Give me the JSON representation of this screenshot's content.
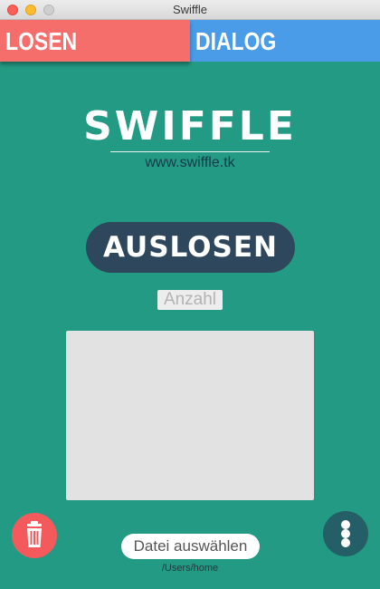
{
  "window": {
    "title": "Swiffle"
  },
  "tabs": [
    {
      "label": "LOSEN",
      "color": "#f56e6c",
      "active": true
    },
    {
      "label": "DIALOG",
      "color": "#4a9be8",
      "active": false
    }
  ],
  "brand": {
    "logo": "SWIFFLE",
    "url": "www.swiffle.tk"
  },
  "draw_button": {
    "label": "AUSLOSEN"
  },
  "count_input": {
    "placeholder": "Anzahl",
    "value": ""
  },
  "file_picker": {
    "label": "Datei auswählen",
    "path": "/Users/home"
  },
  "icons": {
    "delete": "trash-icon",
    "menu": "more-vertical-icon"
  },
  "colors": {
    "background": "#239a83",
    "delete_button": "#f45a5c",
    "menu_button": "#245e67",
    "draw_button": "#2f475c"
  }
}
